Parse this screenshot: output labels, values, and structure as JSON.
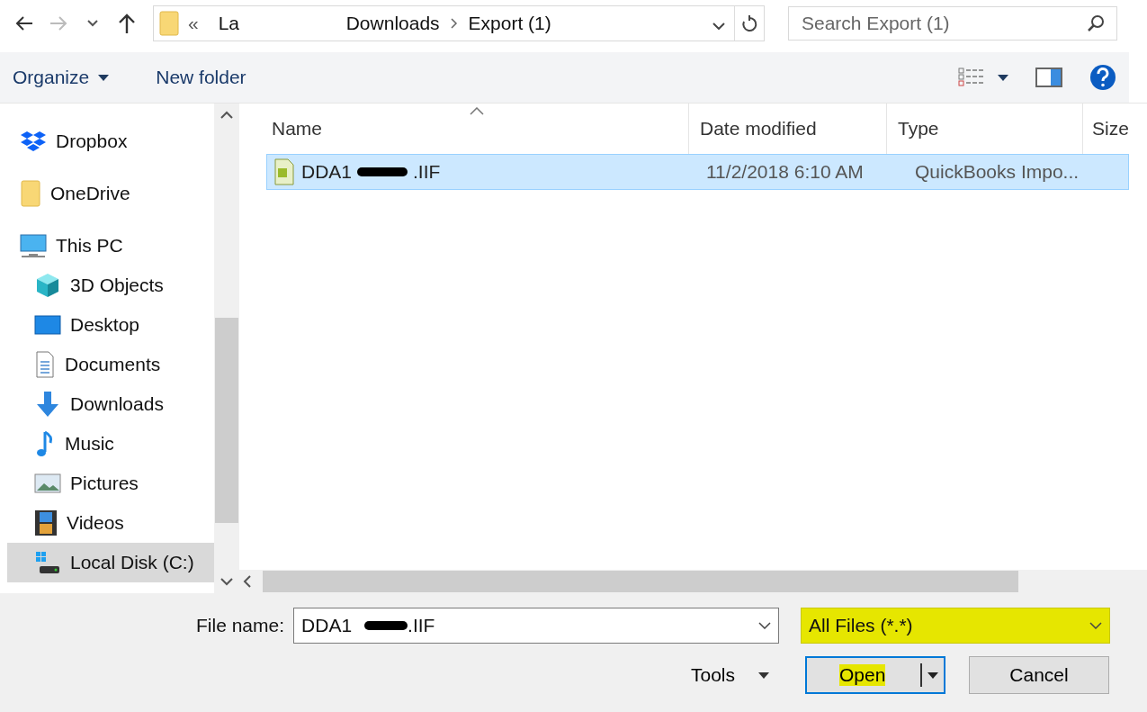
{
  "nav": {
    "breadcrumb": [
      {
        "label": "La"
      },
      {
        "label": "Downloads"
      },
      {
        "label": "Export (1)"
      }
    ],
    "overflow": "«",
    "search": {
      "placeholder": "Search Export (1)"
    }
  },
  "toolbar": {
    "organize": "Organize",
    "new_folder": "New folder"
  },
  "sidebar": {
    "items": [
      {
        "label": "Dropbox",
        "kind": "dropbox",
        "selected": false
      },
      {
        "label": "OneDrive",
        "kind": "folder",
        "selected": false
      },
      {
        "label": "This PC",
        "kind": "pc",
        "selected": false,
        "children": [
          {
            "label": "3D Objects",
            "kind": "objects",
            "selected": false
          },
          {
            "label": "Desktop",
            "kind": "desktop",
            "selected": false
          },
          {
            "label": "Documents",
            "kind": "documents",
            "selected": false
          },
          {
            "label": "Downloads",
            "kind": "downloads",
            "selected": false
          },
          {
            "label": "Music",
            "kind": "music",
            "selected": false
          },
          {
            "label": "Pictures",
            "kind": "pictures",
            "selected": false
          },
          {
            "label": "Videos",
            "kind": "videos",
            "selected": false
          },
          {
            "label": "Local Disk (C:)",
            "kind": "disk",
            "selected": true
          }
        ]
      }
    ]
  },
  "table": {
    "columns": [
      "Name",
      "Date modified",
      "Type",
      "Size"
    ],
    "rows": [
      {
        "name_start": "DDA1",
        "name_end": ".IIF",
        "date": "11/2/2018 6:10 AM",
        "type": "QuickBooks Impo...",
        "selected": true
      }
    ]
  },
  "footer": {
    "file_name_label": "File name:",
    "file_name_start": "DDA1",
    "file_name_end": ".IIF",
    "filter": {
      "value": "All Files (*.*)",
      "highlighted": true
    },
    "tools": "Tools",
    "open": {
      "label": "Open",
      "highlighted": true
    },
    "cancel": "Cancel"
  }
}
